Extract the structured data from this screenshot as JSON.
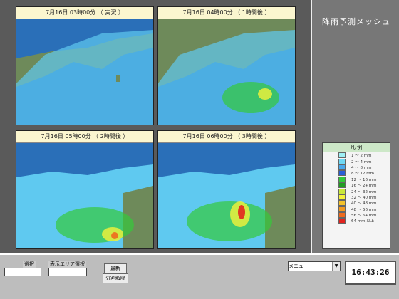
{
  "panels": [
    {
      "title": "7月16日 03時00分 （ 実況 ）"
    },
    {
      "title": "7月16日 04時00分 （ 1時間後 ）"
    },
    {
      "title": "7月16日 05時00分 （ 2時間後 ）"
    },
    {
      "title": "7月16日 06時00分 （ 3時間後 ）"
    }
  ],
  "sidebar": {
    "title": "降雨予測メッシュ"
  },
  "legend": {
    "title": "凡 例",
    "items": [
      {
        "label": "1 〜 2 mm",
        "color": "#9ef0f5"
      },
      {
        "label": "2 〜 4 mm",
        "color": "#6fd9f4"
      },
      {
        "label": "4 〜 8 mm",
        "color": "#49a9ec"
      },
      {
        "label": "8 〜 12 mm",
        "color": "#2a5ed6"
      },
      {
        "label": "12 〜 16 mm",
        "color": "#34c93a"
      },
      {
        "label": "16 〜 24 mm",
        "color": "#229c22"
      },
      {
        "label": "24 〜 32 mm",
        "color": "#c8e83a"
      },
      {
        "label": "32 〜 40 mm",
        "color": "#f5f23a"
      },
      {
        "label": "40 〜 48 mm",
        "color": "#f4c22a"
      },
      {
        "label": "48 〜 56 mm",
        "color": "#f39a1f"
      },
      {
        "label": "56 〜 64 mm",
        "color": "#ee6a1e"
      },
      {
        "label": "64 mm 以上",
        "color": "#e2231f"
      }
    ]
  },
  "controls": {
    "select_label": "選択",
    "area_label": "表示エリア選択",
    "update_label": "最新",
    "split_label": "分割解除",
    "menu_value": "メニュー",
    "time": "16:43:26"
  }
}
